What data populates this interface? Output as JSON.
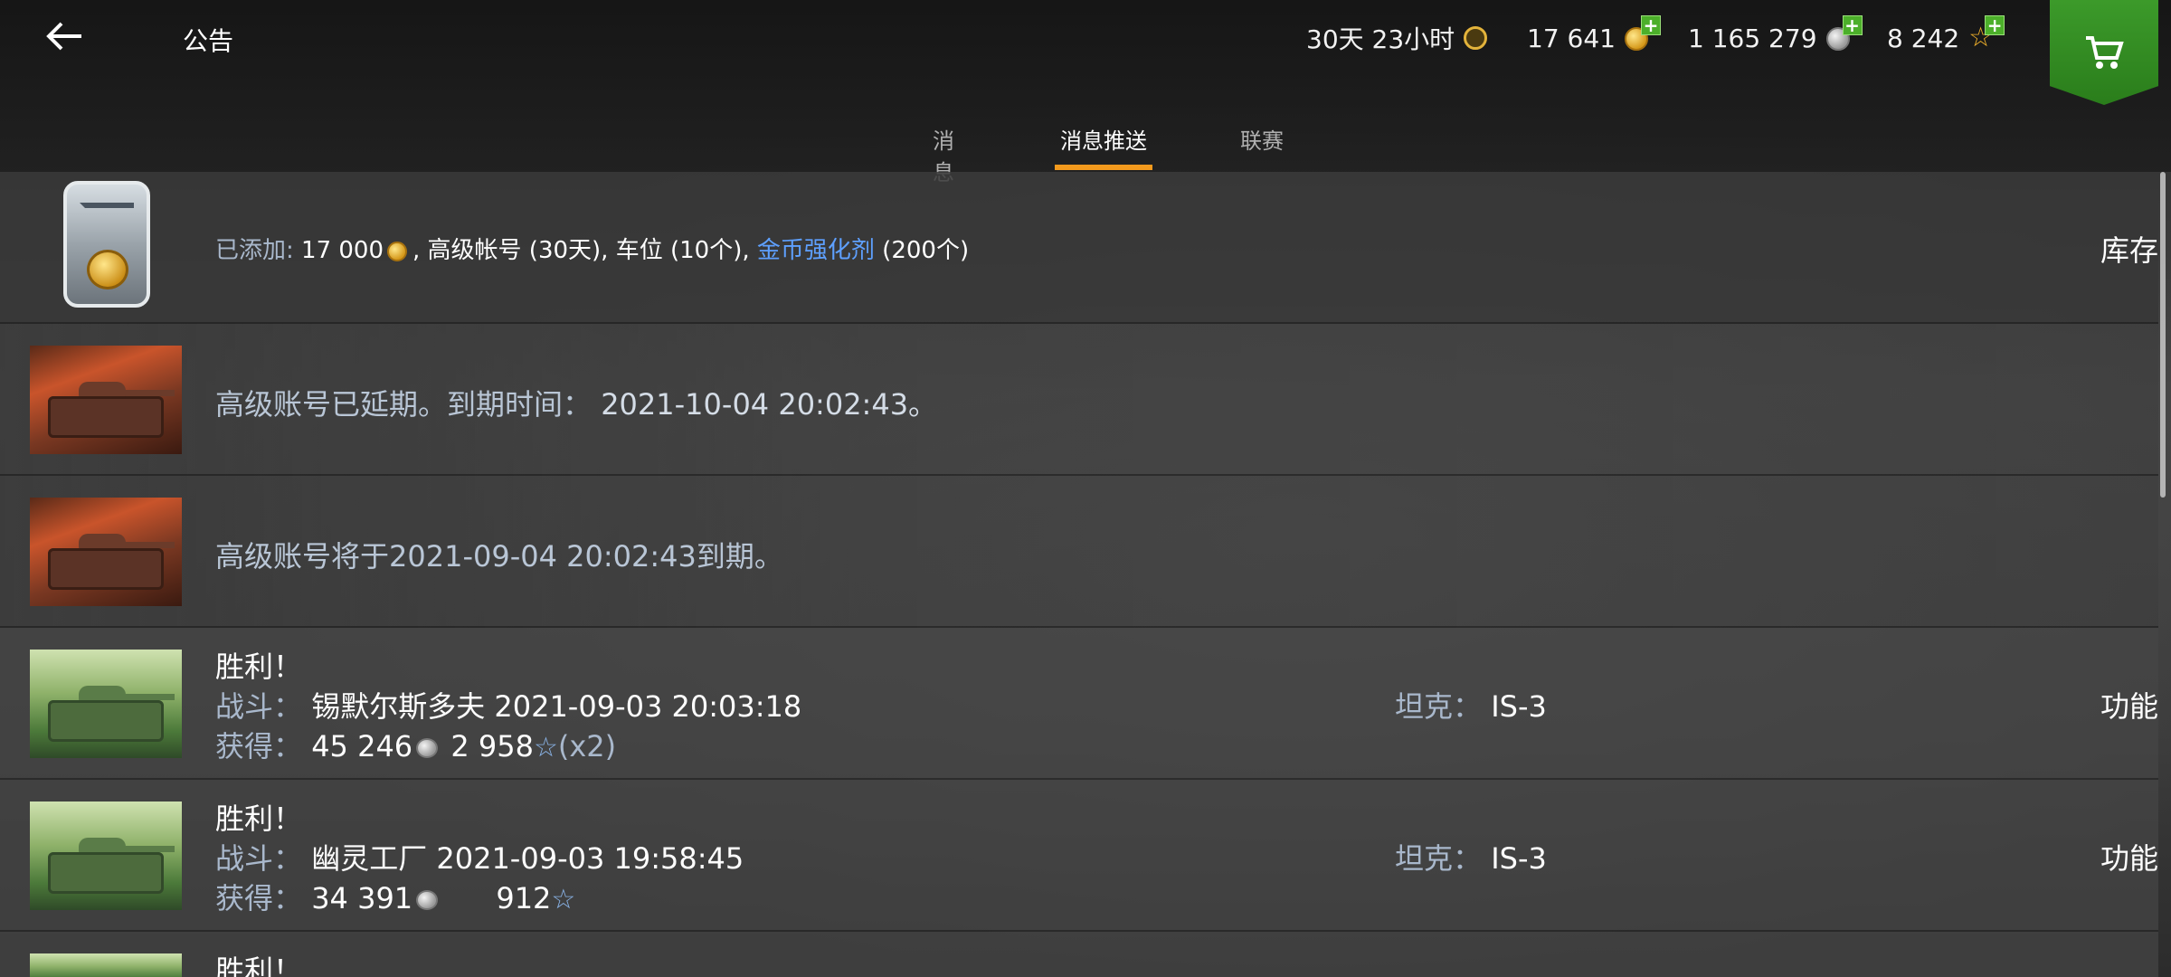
{
  "header": {
    "back_icon": "arrow-left-icon",
    "title": "公告",
    "premium_time": "30天 23小时",
    "gold": "17 641",
    "credits": "1 165 279",
    "free_xp": "8 242",
    "shop_icon": "cart-icon"
  },
  "tabs": [
    {
      "label": "消息",
      "active": false
    },
    {
      "label": "消息推送",
      "active": true
    },
    {
      "label": "联赛",
      "active": false
    }
  ],
  "rows": [
    {
      "type": "added",
      "prefix": "已添加:",
      "gold": "17 000",
      "part1": ", 高级帐号 (30天), 车位 (10个),",
      "link": "金币强化剂",
      "part2": "(200个)",
      "action": "库存"
    },
    {
      "type": "premium",
      "text": "高级账号已延期。到期时间：",
      "date": "2021-10-04 20:02:43。"
    },
    {
      "type": "premium",
      "text": "高级账号将于2021-09-04 20:02:43到期。"
    },
    {
      "type": "battle",
      "title": "胜利！",
      "battle_label": "战斗：",
      "battle_value": "锡默尔斯多夫 2021-09-03 20:03:18",
      "tank_label": "坦克：",
      "tank_value": "IS-3",
      "earn_label": "获得：",
      "credits": "45 246",
      "xp": "2 958",
      "xp_suffix": "(x2)",
      "action": "功能"
    },
    {
      "type": "battle",
      "title": "胜利！",
      "battle_label": "战斗：",
      "battle_value": "幽灵工厂 2021-09-03 19:58:45",
      "tank_label": "坦克：",
      "tank_value": "IS-3",
      "earn_label": "获得：",
      "credits": "34 391",
      "xp": "912",
      "action": "功能"
    },
    {
      "type": "battle",
      "title": "胜利！"
    }
  ]
}
